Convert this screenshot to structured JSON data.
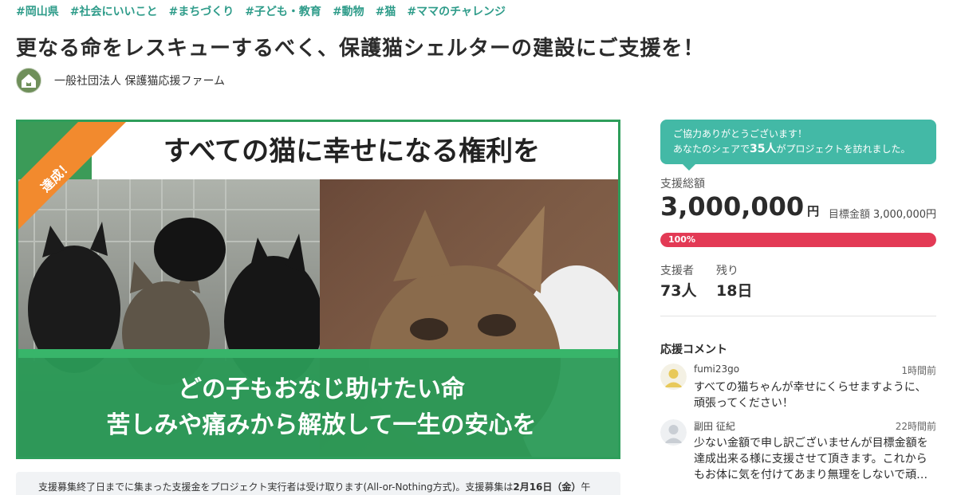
{
  "tags": [
    "#岡山県",
    "#社会にいいこと",
    "#まちづくり",
    "#子ども・教育",
    "#動物",
    "#猫",
    "#ママのチャレンジ"
  ],
  "title": "更なる命をレスキューするべく、保護猫シェルターの建設にご支援を！",
  "owner": {
    "name": "一般社団法人 保護猫応援ファーム",
    "logo_icon": "cat-house-logo"
  },
  "hero": {
    "headline": "すべての猫に幸せになる権利を",
    "line1": "どの子もおなじ助けたい命",
    "line2": "苦しみや痛みから解放して一生の安心を",
    "ribbon": "達成！",
    "colors": {
      "green": "#2e9e5b",
      "ribbon": "#f28a2e"
    }
  },
  "notice": {
    "text": "支援募集終了日までに集まった支援金をプロジェクト実行者は受け取ります(All-or-Nothing方式)。支援募集は",
    "date": "2月16日（金）",
    "tail": "午"
  },
  "thanks": {
    "line1": "ご協力ありがとうございます！",
    "line2_pre": "あなたのシェアで",
    "count": "35人",
    "line2_post": "がプロジェクトを訪れました。"
  },
  "funding": {
    "total_label": "支援総額",
    "total": "3,000,000",
    "unit": "円",
    "target_label": "目標金額",
    "target": "3,000,000円",
    "progress_text": "100%",
    "progress_fraction": 1.0,
    "supporters_label": "支援者",
    "supporters": "73人",
    "remaining_label": "残り",
    "remaining": "18日"
  },
  "comments": {
    "title": "応援コメント",
    "items": [
      {
        "user": "fumi23go",
        "time": "1時間前",
        "text": "すべての猫ちゃんが幸せにくらせますように、頑張ってください！",
        "avatar": "person-yellow-icon"
      },
      {
        "user": "副田 征紀",
        "time": "22時間前",
        "text": "少ない金額で申し訳ございませんが目標金額を達成出来る様に支援させて頂きます。これからもお体に気を付けてあまり無理をしないで頑…",
        "avatar": "person-grey-icon"
      }
    ]
  },
  "colors": {
    "accent": "#2f9c8a",
    "thanks_bg": "#43b9a6",
    "progress": "#e33a55"
  }
}
